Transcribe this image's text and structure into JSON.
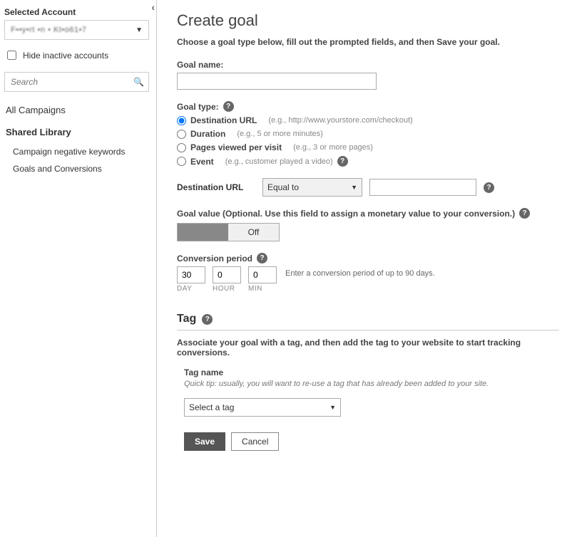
{
  "sidebar": {
    "selected_account_label": "Selected Account",
    "account_name": "F••y•rt •n • Kt•o61•7",
    "hide_inactive_label": "Hide inactive accounts",
    "search_placeholder": "Search",
    "nav": {
      "all_campaigns": "All Campaigns",
      "shared_library": "Shared Library",
      "items": [
        "Campaign negative keywords",
        "Goals and Conversions"
      ]
    }
  },
  "main": {
    "title": "Create goal",
    "intro": "Choose a goal type below, fill out the prompted fields, and then Save your goal.",
    "goal_name_label": "Goal name:",
    "goal_name_value": "",
    "goal_type_label": "Goal type:",
    "goal_types": [
      {
        "label": "Destination URL",
        "hint": "(e.g., http://www.yourstore.com/checkout)",
        "selected": true
      },
      {
        "label": "Duration",
        "hint": "(e.g., 5 or more minutes)",
        "selected": false
      },
      {
        "label": "Pages viewed per visit",
        "hint": "(e.g., 3 or more pages)",
        "selected": false
      },
      {
        "label": "Event",
        "hint": "(e.g., customer played a video)",
        "selected": false
      }
    ],
    "destination": {
      "label": "Destination URL",
      "operator": "Equal to",
      "value": ""
    },
    "goal_value": {
      "label": "Goal value (Optional. Use this field to assign a monetary value to your conversion.)",
      "toggle_off": "Off"
    },
    "conversion": {
      "label": "Conversion period",
      "day": "30",
      "hour": "0",
      "min": "0",
      "unit_day": "DAY",
      "unit_hour": "HOUR",
      "unit_min": "MIN",
      "hint": "Enter a conversion period of up to 90 days."
    },
    "tag": {
      "heading": "Tag",
      "associate": "Associate your goal with a tag, and then add the tag to your website to start tracking conversions.",
      "name_label": "Tag name",
      "tip": "Quick tip: usually, you will want to re-use a tag that has already been added to your site.",
      "select_placeholder": "Select a tag"
    },
    "buttons": {
      "save": "Save",
      "cancel": "Cancel"
    }
  }
}
